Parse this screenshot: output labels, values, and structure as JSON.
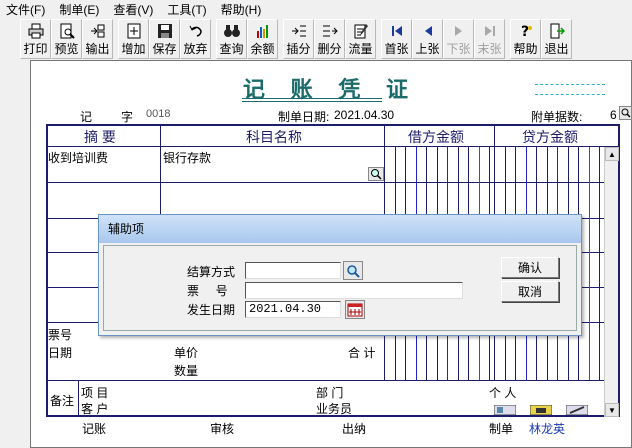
{
  "menu": [
    "文件(F)",
    "制单(E)",
    "查看(V)",
    "工具(T)",
    "帮助(H)"
  ],
  "toolbar": [
    {
      "label": "打印",
      "icon": "printer-icon",
      "enabled": true
    },
    {
      "label": "预览",
      "icon": "preview-icon",
      "enabled": true
    },
    {
      "label": "输出",
      "icon": "export-icon",
      "enabled": true
    },
    {
      "label": "增加",
      "icon": "add-icon",
      "enabled": true
    },
    {
      "label": "保存",
      "icon": "save-icon",
      "enabled": true
    },
    {
      "label": "放弃",
      "icon": "undo-icon",
      "enabled": true
    },
    {
      "label": "查询",
      "icon": "binoculars-icon",
      "enabled": true
    },
    {
      "label": "余额",
      "icon": "balance-chart-icon",
      "enabled": true
    },
    {
      "label": "插分",
      "icon": "insert-row-icon",
      "enabled": true
    },
    {
      "label": "删分",
      "icon": "delete-row-icon",
      "enabled": true
    },
    {
      "label": "流量",
      "icon": "cashflow-icon",
      "enabled": true
    },
    {
      "label": "首张",
      "icon": "first-icon",
      "enabled": true
    },
    {
      "label": "上张",
      "icon": "prev-icon",
      "enabled": true
    },
    {
      "label": "下张",
      "icon": "next-icon",
      "enabled": false
    },
    {
      "label": "末张",
      "icon": "last-icon",
      "enabled": false
    },
    {
      "label": "帮助",
      "icon": "help-icon",
      "enabled": true
    },
    {
      "label": "退出",
      "icon": "exit-icon",
      "enabled": true
    }
  ],
  "voucher": {
    "title": "记 账 凭 证",
    "type_label": "记",
    "no_label": "字",
    "no_value": "0018",
    "date_label": "制单日期:",
    "date_value": "2021.04.30",
    "attach_label": "附单据数:",
    "attach_value": "6"
  },
  "columns": {
    "summary": "摘 要",
    "account": "科目名称",
    "debit": "借方金额",
    "credit": "贷方金额"
  },
  "rows": [
    {
      "summary": "收到培训费",
      "account": "银行存款"
    }
  ],
  "bottom": {
    "ticket_no_label": "票号",
    "date_label": "日期",
    "unit_price_label": "单价",
    "quantity_label": "数量",
    "total_label": "合 计",
    "remark_label": "备注",
    "project_label": "项 目",
    "customer_label": "客 户",
    "dept_label": "部 门",
    "salesman_label": "业务员",
    "person_label": "个 人"
  },
  "footer": {
    "bookkeeper_label": "记账",
    "reviewer_label": "审核",
    "cashier_label": "出纳",
    "maker_label": "制单",
    "maker_name": "林龙英"
  },
  "dialog": {
    "title": "辅助项",
    "settle_label": "结算方式",
    "settle_value": "",
    "ticket_label": "票     号",
    "ticket_value": "",
    "date_label": "发生日期",
    "date_value": "2021.04.30",
    "ok_label": "确认",
    "cancel_label": "取消"
  },
  "colors": {
    "title": "#1b6b6b",
    "grid": "#1d1d6b",
    "blue_line": "#2222cc",
    "red_line": "#d02020",
    "dialog_title_bg": "#a9c8ee"
  }
}
